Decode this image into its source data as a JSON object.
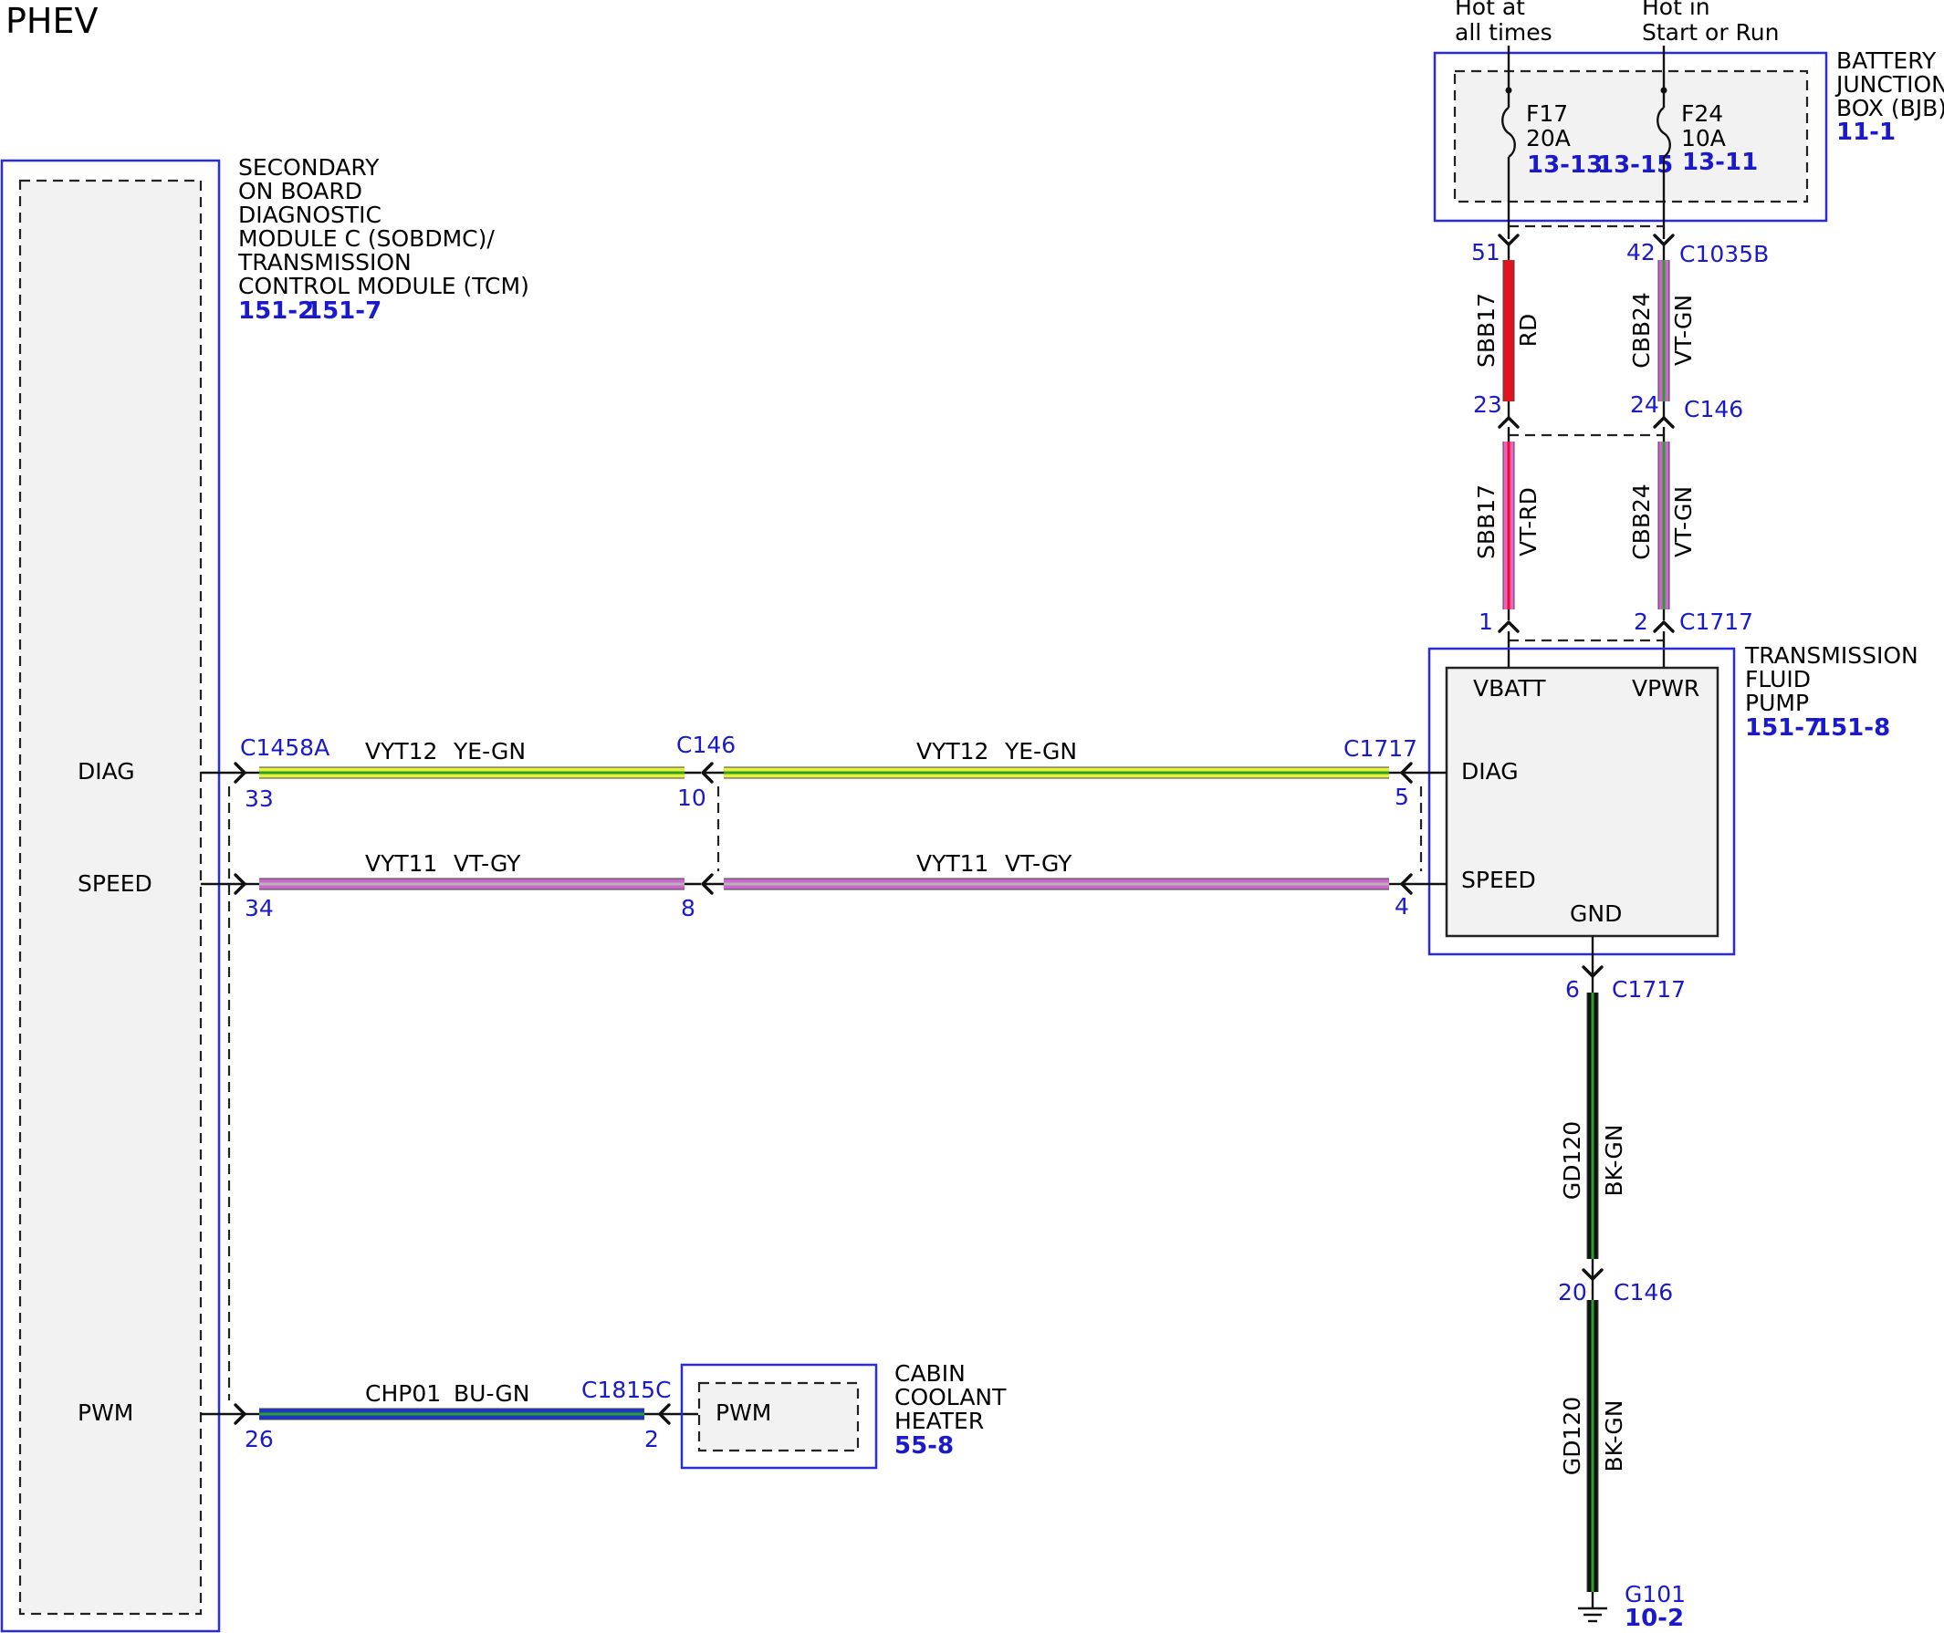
{
  "title": "PHEV",
  "colors": {
    "module_border": "#2a2ae0",
    "link_text": "#1a1acc",
    "RD": "#e0141e",
    "VT": "#cc66cc",
    "PK": "#ee5fc8",
    "YE": "#e8f03a",
    "GN": "#2aa02a",
    "GY": "#b5b5b5",
    "BU": "#1d35c9",
    "BK": "#111111"
  },
  "supply_labels": {
    "f17": [
      "Hot at",
      "all times"
    ],
    "f24": [
      "Hot in",
      "Start or Run"
    ]
  },
  "bjb": {
    "name_lines": [
      "BATTERY",
      "JUNCTION",
      "BOX (BJB)"
    ],
    "ref": "11-1",
    "fuses": [
      {
        "id": "F17",
        "rating": "20A",
        "refs": [
          "13-13",
          "13-15"
        ]
      },
      {
        "id": "F24",
        "rating": "10A",
        "refs": [
          "13-11"
        ]
      }
    ]
  },
  "sobdmc": {
    "name_lines": [
      "SECONDARY",
      "ON BOARD",
      "DIAGNOSTIC",
      "MODULE C (SOBDMC)/",
      "TRANSMISSION",
      "CONTROL MODULE (TCM)"
    ],
    "refs": [
      "151-2",
      "151-7"
    ],
    "pins": [
      "DIAG",
      "SPEED",
      "PWM"
    ]
  },
  "tfp": {
    "name_lines": [
      "TRANSMISSION",
      "FLUID",
      "PUMP"
    ],
    "refs": [
      "151-7",
      "151-8"
    ],
    "pins": [
      "VBATT",
      "VPWR",
      "DIAG",
      "SPEED",
      "GND"
    ]
  },
  "cch": {
    "name_lines": [
      "CABIN",
      "COOLANT",
      "HEATER"
    ],
    "ref": "55-8",
    "pin": "PWM"
  },
  "connectors": {
    "c1035b": "C1035B",
    "c146": "C146",
    "c1717": "C1717",
    "c1458a": "C1458A",
    "c1815c": "C1815C"
  },
  "pins": {
    "p51": "51",
    "p42": "42",
    "p23": "23",
    "p24": "24",
    "p1": "1",
    "p2": "2",
    "p33": "33",
    "p10": "10",
    "p5": "5",
    "p34": "34",
    "p8": "8",
    "p4": "4",
    "p26": "26",
    "p2b": "2",
    "p6": "6",
    "p20": "20"
  },
  "wires": [
    {
      "id": "w-sbb17-upper",
      "circuit": "SBB17",
      "color": "RD",
      "stripes": [
        "RD"
      ]
    },
    {
      "id": "w-cbb24-upper",
      "circuit": "CBB24",
      "color": "VT-GN",
      "stripes": [
        "VT",
        "GN"
      ]
    },
    {
      "id": "w-sbb17-lower",
      "circuit": "SBB17",
      "color": "VT-RD",
      "stripes": [
        "PK",
        "RD"
      ]
    },
    {
      "id": "w-cbb24-lower",
      "circuit": "CBB24",
      "color": "VT-GN",
      "stripes": [
        "VT",
        "GN"
      ]
    },
    {
      "id": "w-vyt12-left",
      "circuit": "VYT12",
      "color": "YE-GN",
      "stripes": [
        "YE",
        "GN"
      ]
    },
    {
      "id": "w-vyt12-right",
      "circuit": "VYT12",
      "color": "YE-GN",
      "stripes": [
        "YE",
        "GN"
      ]
    },
    {
      "id": "w-vyt11-left",
      "circuit": "VYT11",
      "color": "VT-GY",
      "stripes": [
        "VT",
        "GY"
      ]
    },
    {
      "id": "w-vyt11-right",
      "circuit": "VYT11",
      "color": "VT-GY",
      "stripes": [
        "VT",
        "GY"
      ]
    },
    {
      "id": "w-chp01",
      "circuit": "CHP01",
      "color": "BU-GN",
      "stripes": [
        "BU",
        "GN"
      ]
    },
    {
      "id": "w-gd120-upper",
      "circuit": "GD120",
      "color": "BK-GN",
      "stripes": [
        "BK",
        "GN"
      ]
    },
    {
      "id": "w-gd120-lower",
      "circuit": "GD120",
      "color": "BK-GN",
      "stripes": [
        "BK",
        "GN"
      ]
    }
  ],
  "ground": {
    "id": "G101",
    "ref": "10-2"
  }
}
